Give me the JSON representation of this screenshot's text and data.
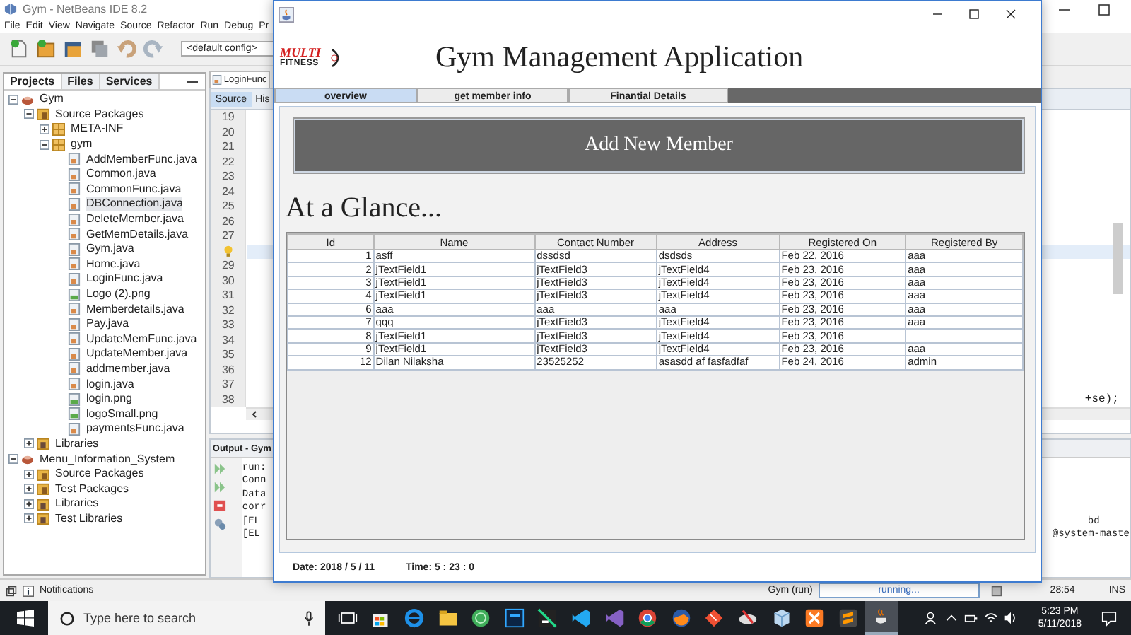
{
  "ide": {
    "title": "Gym - NetBeans IDE 8.2",
    "menu": [
      "File",
      "Edit",
      "View",
      "Navigate",
      "Source",
      "Refactor",
      "Run",
      "Debug",
      "Pr"
    ],
    "config": "<default config>",
    "panel_tabs": [
      {
        "label": "Projects",
        "selected": true
      },
      {
        "label": "Files",
        "selected": false
      },
      {
        "label": "Services",
        "selected": false
      }
    ],
    "tree": [
      {
        "label": "Gym",
        "kind": "project",
        "expanded": true,
        "selected": false,
        "children": [
          {
            "label": "Source Packages",
            "kind": "folder",
            "expanded": true,
            "selected": false,
            "children": [
              {
                "label": "META-INF",
                "kind": "package",
                "expanded": false,
                "selected": false
              },
              {
                "label": "gym",
                "kind": "package",
                "expanded": true,
                "selected": false,
                "children": [
                  {
                    "label": "AddMemberFunc.java",
                    "kind": "java",
                    "selected": false
                  },
                  {
                    "label": "Common.java",
                    "kind": "java",
                    "selected": false
                  },
                  {
                    "label": "CommonFunc.java",
                    "kind": "java",
                    "selected": false
                  },
                  {
                    "label": "DBConnection.java",
                    "kind": "java",
                    "selected": true
                  },
                  {
                    "label": "DeleteMember.java",
                    "kind": "java",
                    "selected": false
                  },
                  {
                    "label": "GetMemDetails.java",
                    "kind": "java",
                    "selected": false
                  },
                  {
                    "label": "Gym.java",
                    "kind": "java",
                    "selected": false
                  },
                  {
                    "label": "Home.java",
                    "kind": "java",
                    "selected": false
                  },
                  {
                    "label": "LoginFunc.java",
                    "kind": "java",
                    "selected": false
                  },
                  {
                    "label": "Logo (2).png",
                    "kind": "image",
                    "selected": false
                  },
                  {
                    "label": "Memberdetails.java",
                    "kind": "java",
                    "selected": false
                  },
                  {
                    "label": "Pay.java",
                    "kind": "java",
                    "selected": false
                  },
                  {
                    "label": "UpdateMemFunc.java",
                    "kind": "java",
                    "selected": false
                  },
                  {
                    "label": "UpdateMember.java",
                    "kind": "java",
                    "selected": false
                  },
                  {
                    "label": "addmember.java",
                    "kind": "java",
                    "selected": false
                  },
                  {
                    "label": "login.java",
                    "kind": "java",
                    "selected": false
                  },
                  {
                    "label": "login.png",
                    "kind": "image",
                    "selected": false
                  },
                  {
                    "label": "logoSmall.png",
                    "kind": "image",
                    "selected": false
                  },
                  {
                    "label": "paymentsFunc.java",
                    "kind": "java",
                    "selected": false
                  }
                ]
              }
            ]
          },
          {
            "label": "Libraries",
            "kind": "library",
            "expanded": false,
            "selected": false
          }
        ]
      },
      {
        "label": "Menu_Information_System",
        "kind": "project",
        "expanded": true,
        "selected": false,
        "children": [
          {
            "label": "Source Packages",
            "kind": "folder",
            "expanded": false,
            "selected": false
          },
          {
            "label": "Test Packages",
            "kind": "folder",
            "expanded": false,
            "selected": false
          },
          {
            "label": "Libraries",
            "kind": "library",
            "expanded": false,
            "selected": false
          },
          {
            "label": "Test Libraries",
            "kind": "library",
            "expanded": false,
            "selected": false
          }
        ]
      }
    ],
    "editor_tab": "LoginFunc",
    "editor_views": [
      {
        "label": "Source",
        "selected": true
      },
      {
        "label": "His",
        "selected": false
      }
    ],
    "gutter": [
      {
        "kind": "number",
        "text": "19",
        "current": false
      },
      {
        "kind": "number",
        "text": "20",
        "current": false
      },
      {
        "kind": "number",
        "text": "21",
        "current": false
      },
      {
        "kind": "number",
        "text": "22",
        "current": false
      },
      {
        "kind": "number",
        "text": "23",
        "current": false
      },
      {
        "kind": "number",
        "text": "24",
        "current": false
      },
      {
        "kind": "number",
        "text": "25",
        "current": false
      },
      {
        "kind": "number",
        "text": "26",
        "current": false
      },
      {
        "kind": "number",
        "text": "27",
        "current": false
      },
      {
        "kind": "hint",
        "current": true
      },
      {
        "kind": "number",
        "text": "29",
        "current": false
      },
      {
        "kind": "number",
        "text": "30",
        "current": false
      },
      {
        "kind": "number",
        "text": "31",
        "current": false
      },
      {
        "kind": "number",
        "text": "32",
        "current": false
      },
      {
        "kind": "number",
        "text": "33",
        "current": false
      },
      {
        "kind": "number",
        "text": "34",
        "current": false
      },
      {
        "kind": "number",
        "text": "35",
        "current": false
      },
      {
        "kind": "number",
        "text": "36",
        "current": false
      },
      {
        "kind": "number",
        "text": "37",
        "current": false
      },
      {
        "kind": "number",
        "text": "38",
        "current": false,
        "tail": "+se);"
      }
    ],
    "output_title": "Output - Gym",
    "output_lines": [
      {
        "start": "run:"
      },
      {
        "start": "Conn"
      },
      {
        "start": "Data"
      },
      {
        "start": "corr"
      },
      {
        "start": "[EL",
        "end": "bd"
      },
      {
        "start": "[EL",
        "end": "@system-maste"
      }
    ],
    "status": {
      "notifications": "Notifications",
      "task": "Gym (run)",
      "progress": "running...",
      "position": "28:54",
      "mode": "INS"
    }
  },
  "app": {
    "logo": {
      "line1": "MULTI",
      "line2": "FITNESS"
    },
    "heading": "Gym Management Application",
    "tabs": [
      {
        "label": "overview",
        "selected": true
      },
      {
        "label": "get member info",
        "selected": false
      },
      {
        "label": "Finantial Details",
        "selected": false
      }
    ],
    "button": "Add New Member",
    "section_title": "At a Glance...",
    "table": {
      "columns": [
        "Id",
        "Name",
        "Contact Number",
        "Address",
        "Registered On",
        "Registered By"
      ],
      "rows": [
        [
          "1",
          "asff",
          "dssdsd",
          "dsdsds",
          "Feb 22, 2016",
          "aaa"
        ],
        [
          "2",
          "jTextField1",
          "jTextField3",
          "jTextField4",
          "Feb 23, 2016",
          "aaa"
        ],
        [
          "3",
          "jTextField1",
          "jTextField3",
          "jTextField4",
          "Feb 23, 2016",
          "aaa"
        ],
        [
          "4",
          "jTextField1",
          "jTextField3",
          "jTextField4",
          "Feb 23, 2016",
          "aaa"
        ],
        [
          "6",
          "aaa",
          "aaa",
          "aaa",
          "Feb 23, 2016",
          "aaa"
        ],
        [
          "7",
          "qqq",
          "jTextField3",
          "jTextField4",
          "Feb 23, 2016",
          "aaa"
        ],
        [
          "8",
          "jTextField1",
          "jTextField3",
          "jTextField4",
          "Feb 23, 2016",
          ""
        ],
        [
          "9",
          "jTextField1",
          "jTextField3",
          "jTextField4",
          "Feb 23, 2016",
          "aaa"
        ],
        [
          "12",
          "Dilan Nilaksha",
          "23525252",
          "asasdd af fasfadfaf",
          "Feb 24, 2016",
          "admin"
        ]
      ]
    },
    "date": "Date: 2018 / 5 / 11",
    "time": "Time: 5 : 23 : 0"
  },
  "taskbar": {
    "search": {
      "placeholder": "Type here to search"
    },
    "time": "5:23 PM",
    "date": "5/11/2018"
  }
}
